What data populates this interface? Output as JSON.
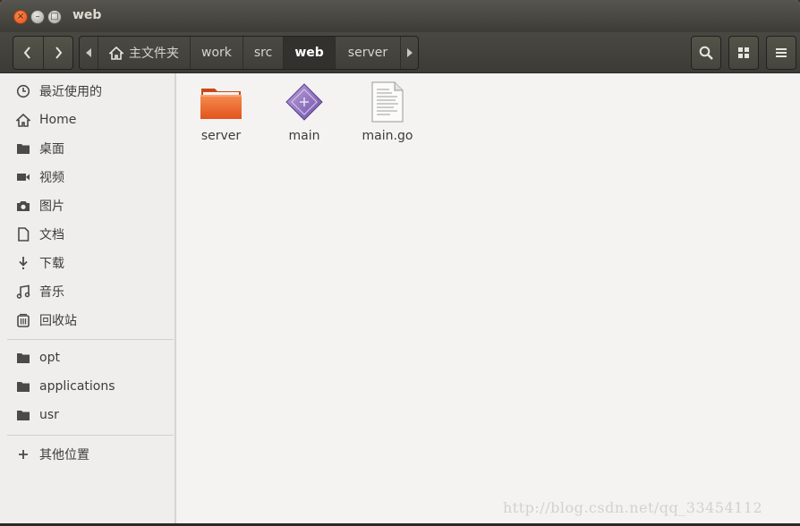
{
  "window": {
    "title": "web",
    "close_glyph": "×",
    "min_glyph": "–",
    "max_glyph": "□"
  },
  "toolbar": {
    "back_icon": "chevron-left-icon",
    "forward_icon": "chevron-right-icon",
    "crumbs": [
      "主文件夹",
      "work",
      "src",
      "web",
      "server"
    ],
    "active_crumb": "web",
    "search_icon": "search-icon",
    "view_icon": "grid-view-icon",
    "menu_icon": "hamburger-menu-icon"
  },
  "sidebar": {
    "items": [
      {
        "label": "最近使用的",
        "icon": "clock-icon"
      },
      {
        "label": "Home",
        "icon": "home-icon"
      },
      {
        "label": "桌面",
        "icon": "folder-icon"
      },
      {
        "label": "视频",
        "icon": "video-icon"
      },
      {
        "label": "图片",
        "icon": "camera-icon"
      },
      {
        "label": "文档",
        "icon": "document-icon"
      },
      {
        "label": "下载",
        "icon": "download-icon"
      },
      {
        "label": "音乐",
        "icon": "music-icon"
      },
      {
        "label": "回收站",
        "icon": "trash-icon"
      }
    ],
    "bookmarks": [
      {
        "label": "opt",
        "icon": "folder-icon"
      },
      {
        "label": "applications",
        "icon": "folder-icon"
      },
      {
        "label": "usr",
        "icon": "folder-icon"
      }
    ],
    "other": {
      "label": "其他位置",
      "icon": "plus-icon"
    }
  },
  "files": [
    {
      "name": "server",
      "icon": "orange-folder-icon"
    },
    {
      "name": "main",
      "icon": "executable-diamond-icon"
    },
    {
      "name": "main.go",
      "icon": "text-file-icon"
    }
  ],
  "watermark": "http://blog.csdn.net/qq_33454112"
}
